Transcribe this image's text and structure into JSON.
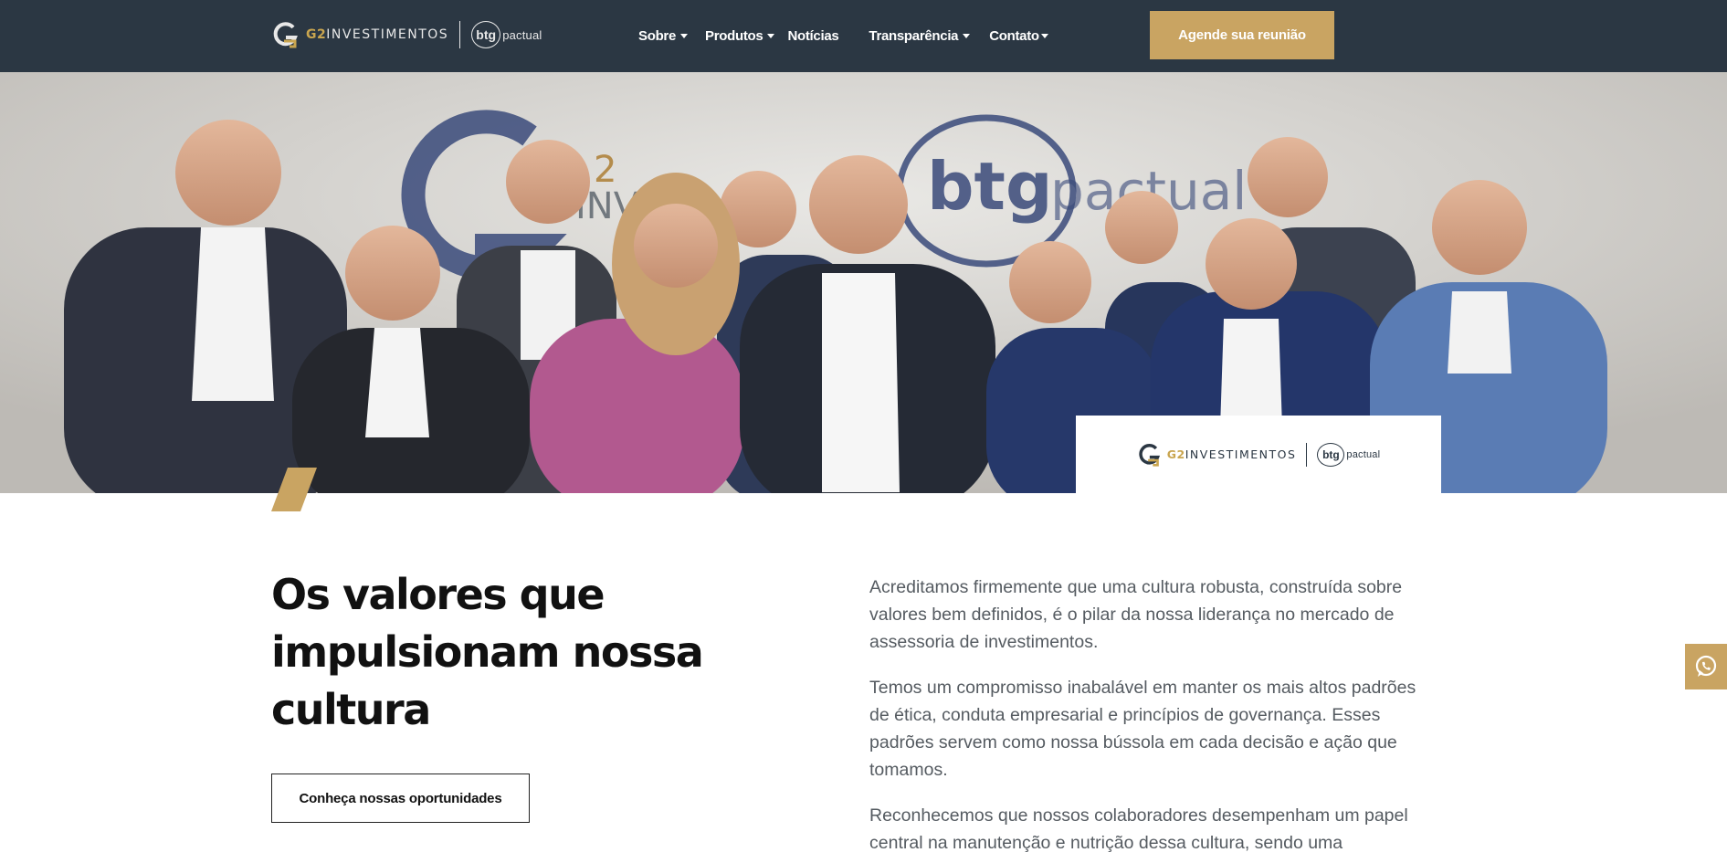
{
  "header": {
    "brand": {
      "prefix": "G2",
      "name": "INVESTIMENTOS",
      "partner_mark": "btg",
      "partner_sub": "pactual"
    },
    "nav": [
      {
        "label": "Sobre",
        "has_dropdown": true
      },
      {
        "label": "Produtos",
        "has_dropdown": true
      },
      {
        "label": "Notícias",
        "has_dropdown": false
      },
      {
        "label": "Transparência",
        "has_dropdown": true
      },
      {
        "label": "Contato",
        "has_dropdown": true
      }
    ],
    "cta_label": "Agende sua reunião"
  },
  "hero": {
    "image_icon": "team-photo",
    "card_brand": {
      "prefix": "G2",
      "name": "INVESTIMENTOS",
      "partner_mark": "btg",
      "partner_sub": "pactual"
    }
  },
  "content": {
    "headline": "Os valores que impulsionam nossa cultura",
    "button_label": "Conheça nossas oportunidades",
    "paragraphs": [
      "Acreditamos firmemente que uma cultura robusta, construída sobre valores bem definidos, é o pilar da nossa liderança no mercado de assessoria de investimentos.",
      "Temos um compromisso inabalável em manter os mais altos padrões de ética, conduta empresarial e princípios de governança. Esses padrões servem como nossa bússola em cada decisão e ação que tomamos.",
      "Reconhecemos que nossos colaboradores desempenham um papel central na manutenção e nutrição dessa cultura, sendo uma"
    ]
  },
  "floating": {
    "icon": "whatsapp-icon"
  },
  "colors": {
    "header_bg": "#2b3743",
    "accent_gold": "#c9a462",
    "text_dark": "#111111",
    "text_body": "#555b61"
  }
}
